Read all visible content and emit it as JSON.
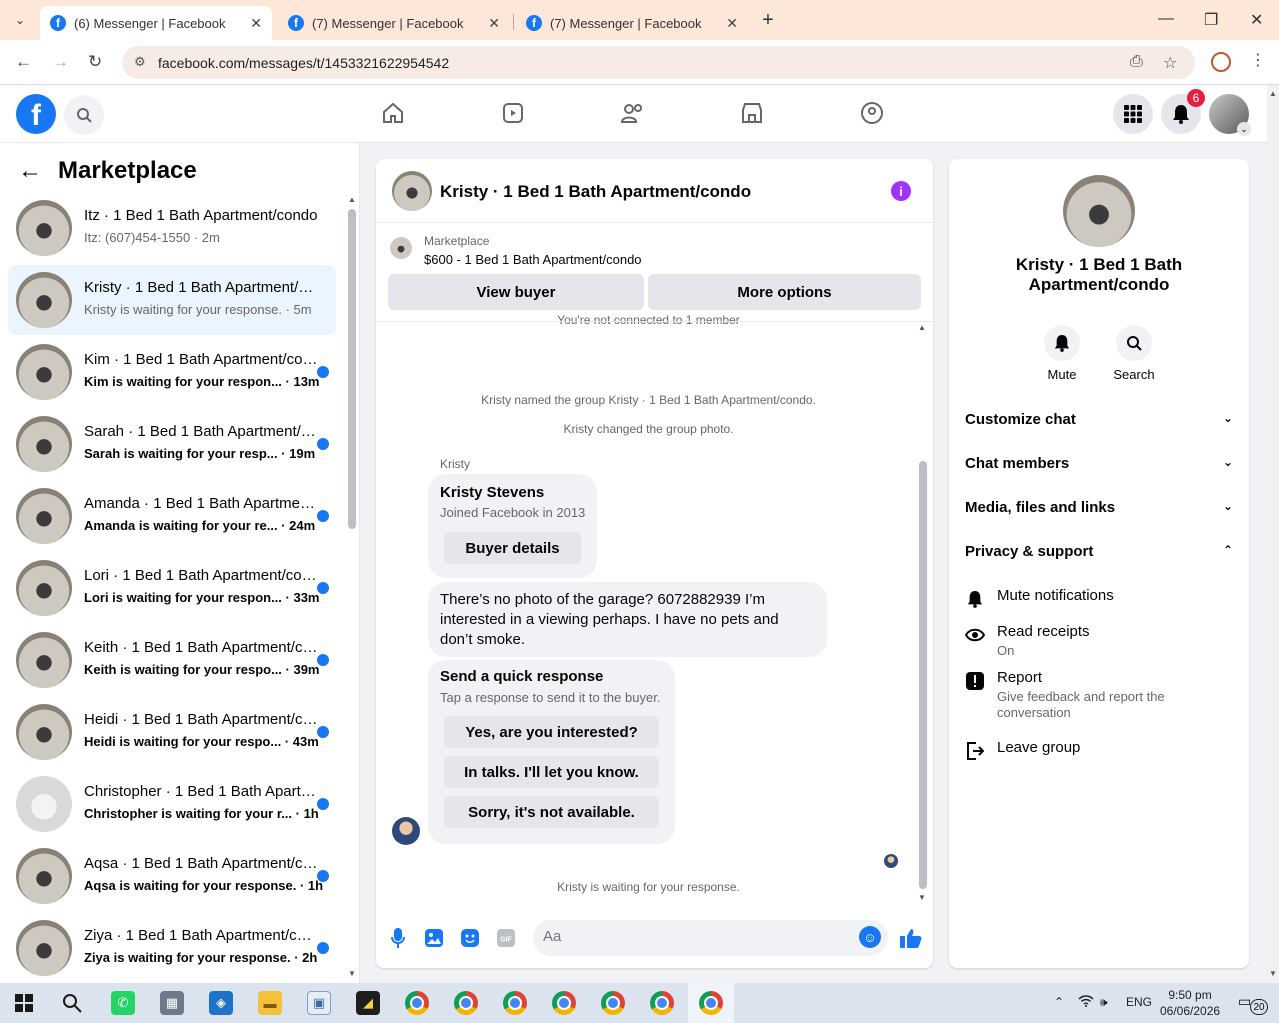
{
  "browser": {
    "tabs": [
      {
        "title": "(6) Messenger | Facebook",
        "active": true
      },
      {
        "title": "(7) Messenger | Facebook",
        "active": false
      },
      {
        "title": "(7) Messenger | Facebook",
        "active": false
      }
    ],
    "url": "facebook.com/messages/t/1453321622954542"
  },
  "fb": {
    "notification_count": "6"
  },
  "sidebar": {
    "title": "Marketplace",
    "conversations": [
      {
        "name": "Itz · 1 Bed 1 Bath Apartment/condo",
        "sub": "Itz: (607)454-1550 · 2m",
        "unread": false,
        "selected": false
      },
      {
        "name": "Kristy · 1 Bed 1 Bath Apartment/condo",
        "sub": "Kristy is waiting for your response. · 5m",
        "unread": false,
        "selected": true
      },
      {
        "name": "Kim · 1 Bed 1 Bath Apartment/condo",
        "sub": "Kim is waiting for your respon... · 13m",
        "unread": true,
        "selected": false
      },
      {
        "name": "Sarah · 1 Bed 1 Bath Apartment/condo",
        "sub": "Sarah is waiting for your resp... · 19m",
        "unread": true,
        "selected": false
      },
      {
        "name": "Amanda · 1 Bed 1 Bath Apartment/condo",
        "sub": "Amanda is waiting for your re... · 24m",
        "unread": true,
        "selected": false
      },
      {
        "name": "Lori · 1 Bed 1 Bath Apartment/condo",
        "sub": "Lori is waiting for your respon... · 33m",
        "unread": true,
        "selected": false
      },
      {
        "name": "Keith · 1 Bed 1 Bath Apartment/condo",
        "sub": "Keith is waiting for your respo... · 39m",
        "unread": true,
        "selected": false
      },
      {
        "name": "Heidi · 1 Bed 1 Bath Apartment/condo",
        "sub": "Heidi is waiting for your respo... · 43m",
        "unread": true,
        "selected": false
      },
      {
        "name": "Christopher · 1 Bed 1 Bath Apartment/condo",
        "sub": "Christopher is waiting for your r... · 1h",
        "unread": true,
        "selected": false
      },
      {
        "name": "Aqsa · 1 Bed 1 Bath Apartment/condo",
        "sub": "Aqsa is waiting for your response. · 1h",
        "unread": true,
        "selected": false
      },
      {
        "name": "Ziya · 1 Bed 1 Bath Apartment/condo",
        "sub": "Ziya is waiting for your response. · 2h",
        "unread": true,
        "selected": false
      }
    ]
  },
  "chat": {
    "title": "Kristy · 1 Bed 1 Bath Apartment/condo",
    "marketplace_label": "Marketplace",
    "listing": "$600 - 1 Bed 1 Bath Apartment/condo",
    "view_buyer": "View buyer",
    "more_options": "More options",
    "not_connected": "You're not connected to 1 member",
    "system1": "Kristy named the group Kristy · 1 Bed 1 Bath Apartment/condo.",
    "system2": "Kristy changed the group photo.",
    "sender": "Kristy",
    "card_name": "Kristy Stevens",
    "card_joined": "Joined Facebook in 2013",
    "card_button": "Buyer details",
    "message": "There’s no photo of the garage? 6072882939 I’m interested in a viewing perhaps. I have no pets and don’t smoke.",
    "quick_title": "Send a quick response",
    "quick_sub": "Tap a response to send it to the buyer.",
    "quick_options": [
      "Yes, are you interested?",
      "In talks. I'll let you know.",
      "Sorry, it's not available."
    ],
    "waiting": "Kristy is waiting for your response.",
    "composer_placeholder": "Aa"
  },
  "info": {
    "name": "Kristy · 1 Bed 1 Bath Apartment/condo",
    "mute": "Mute",
    "search": "Search",
    "sections": [
      "Customize chat",
      "Chat members",
      "Media, files and links",
      "Privacy & support"
    ],
    "mute_notifications": "Mute notifications",
    "read_receipts": "Read receipts",
    "read_receipts_state": "On",
    "report": "Report",
    "report_desc": "Give feedback and report the conversation",
    "leave": "Leave group"
  },
  "taskbar": {
    "lang": "ENG",
    "time": "9:50 pm",
    "date": "06/06/2026",
    "notif_count": "20"
  }
}
